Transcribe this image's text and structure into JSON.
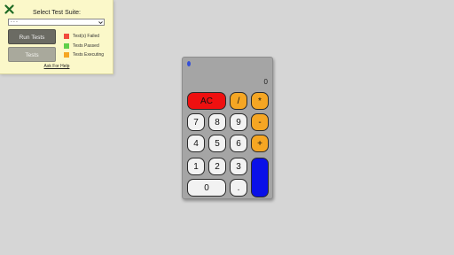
{
  "panel": {
    "title": "Select Test Suite:",
    "select_value": "- - -",
    "run_button": "Run Tests",
    "tests_button": "Tests",
    "legend": [
      {
        "label": "Test(s) Failed",
        "color": "#f24b3d"
      },
      {
        "label": "Tests Passed",
        "color": "#5fcf4a"
      },
      {
        "label": "Tests Executing",
        "color": "#f5a623"
      }
    ],
    "help_link": "Ask For Help"
  },
  "calculator": {
    "display": "0",
    "keys": {
      "ac": "AC",
      "divide": "/",
      "multiply": "*",
      "subtract": "-",
      "add": "+",
      "equals": "",
      "decimal": ".",
      "n0": "0",
      "n1": "1",
      "n2": "2",
      "n3": "3",
      "n4": "4",
      "n5": "5",
      "n6": "6",
      "n7": "7",
      "n8": "8",
      "n9": "9"
    }
  },
  "colors": {
    "panel_bg": "#fbf8c9",
    "calc_body": "#a5a5a5",
    "operator": "#f5a623",
    "clear": "#ef1010",
    "equals": "#0a10e8"
  }
}
